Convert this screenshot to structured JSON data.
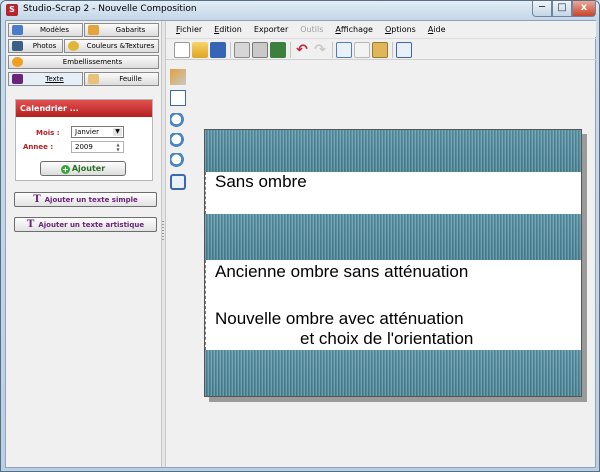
{
  "window": {
    "title": "Studio-Scrap 2 - Nouvelle Composition",
    "min_label": "─",
    "max_label": "□",
    "close_label": "x"
  },
  "left_tabs": {
    "modeles": "Modèles",
    "gabarits": "Gabarits",
    "photos": "Photos",
    "couleurs": "Couleurs &Textures",
    "embellissements": "Embellissements",
    "texte": "Texte",
    "feuille": "Feuille"
  },
  "calendar": {
    "header": "Calendrier ...",
    "mois_label": "Mois :",
    "mois_value": "Janvier",
    "annee_label": "Annee :",
    "annee_value": "2009",
    "add_label": "Ajouter"
  },
  "text_buttons": {
    "simple": "Ajouter un texte simple",
    "artistic": "Ajouter un texte artistique"
  },
  "menu": [
    {
      "key": "F",
      "rest": "ichier",
      "disabled": false
    },
    {
      "key": "E",
      "rest": "dition",
      "disabled": false
    },
    {
      "key": "",
      "rest": "Exporter",
      "disabled": false
    },
    {
      "key": "",
      "rest": "Outils",
      "disabled": true
    },
    {
      "key": "A",
      "rest": "ffichage",
      "disabled": false
    },
    {
      "key": "O",
      "rest": "ptions",
      "disabled": false
    },
    {
      "key": "A",
      "rest": "ide",
      "disabled": false
    }
  ],
  "menu_labels": {
    "fichier_k": "F",
    "fichier_r": "ichier",
    "edition_k": "E",
    "edition_r": "dition",
    "exporter": "Exporter",
    "outils": "Outils",
    "affichage_k": "A",
    "affichage_r": "ffichage",
    "options_k": "O",
    "options_r": "ptions",
    "aide_k": "A",
    "aide_r": "ide"
  },
  "page_texts": {
    "line1": "Sans ombre",
    "line2": "Ancienne ombre sans atténuation",
    "line3": "Nouvelle ombre avec atténuation",
    "line4": "et choix de l'orientation"
  },
  "icons": {
    "toolbar": [
      "new-document-icon",
      "open-folder-icon",
      "save-icon",
      "print-preview-icon",
      "print-icon",
      "export-icon",
      "undo-icon",
      "redo-icon",
      "copy-icon",
      "cut-icon",
      "paste-icon",
      "fit-page-icon"
    ],
    "vertical": [
      "tools-icon",
      "list-icon",
      "zoom-in-icon",
      "zoom-out-icon",
      "zoom-fit-icon",
      "full-view-icon"
    ]
  },
  "colors": {
    "accent_red": "#b51f1f",
    "text_purple": "#6a247a",
    "texture_teal": "#5d95a8"
  }
}
